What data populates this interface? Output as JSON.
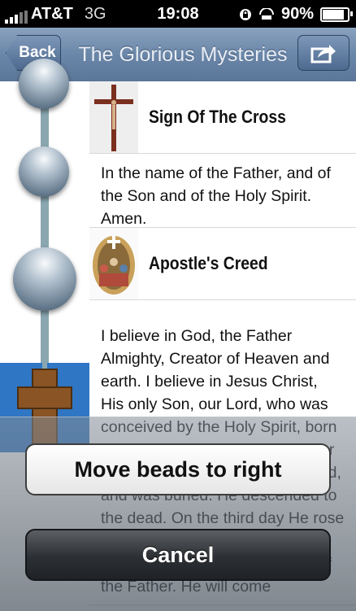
{
  "status_bar": {
    "carrier": "AT&T",
    "network": "3G",
    "time": "19:08",
    "battery": "90%"
  },
  "nav": {
    "back_label": "Back",
    "title": "The Glorious Mysteries",
    "share_icon": "share-icon"
  },
  "prayers": [
    {
      "title": "Sign Of The Cross",
      "image": "crucifix-image",
      "text": "In the name of the Father, and of the Son and of the Holy Spirit. Amen."
    },
    {
      "title": "Apostle's Creed",
      "image": "apostles-image",
      "text": "I believe in God, the Father Almighty, Creator of Heaven and earth. I believe in Jesus Christ, His only Son, our Lord, who was conceived by the Holy Spirit, born of the Virgin Mary, suffered under Pontius Pilate, was crucified, died, and was buried. He descended to the dead. On the third day He rose again. He ascended into Heaven and is seated at the right hand of the Father. He will come"
    }
  ],
  "action_sheet": {
    "move_label": "Move beads to right",
    "cancel_label": "Cancel"
  },
  "colors": {
    "nav_bar": "#6a86a8",
    "cross_background": "#2f76c4",
    "bead_string": "#8aa7b1"
  }
}
